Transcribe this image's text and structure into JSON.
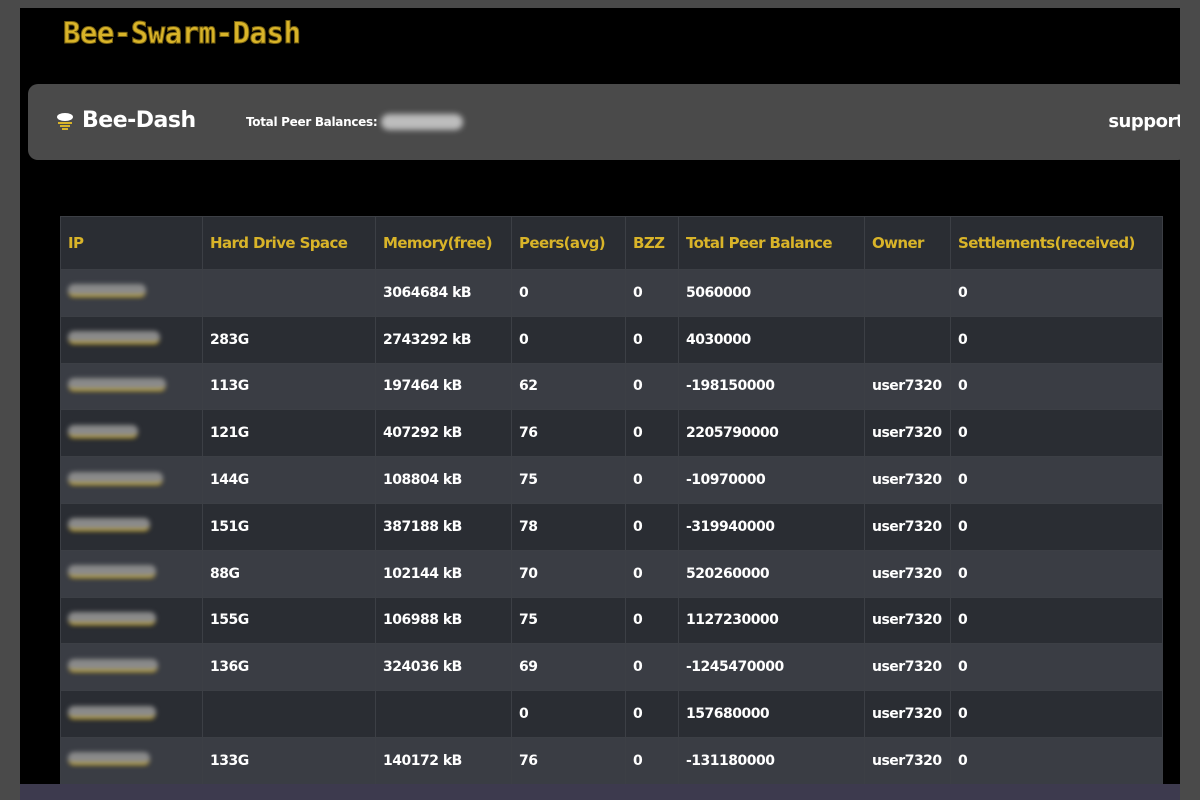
{
  "app_title": "Bee-Swarm-Dash",
  "navbar": {
    "brand": "Bee-Dash",
    "brand_icon": "bee-icon",
    "total_peer_balances_label": "Total Peer Balances:",
    "support_label": "support"
  },
  "colors": {
    "accent": "#d9b429",
    "background": "#000000",
    "navbar": "#4a4a4a",
    "row_dark": "#2a2d33",
    "row_light": "#3a3d44"
  },
  "table": {
    "headers": [
      "IP",
      "Hard Drive Space",
      "Memory(free)",
      "Peers(avg)",
      "BZZ",
      "Total Peer Balance",
      "Owner",
      "Settlements(received)"
    ],
    "rows": [
      {
        "hdd": "",
        "memory": "3064684 kB",
        "peers": "0",
        "bzz": "0",
        "balance": "5060000",
        "owner": "",
        "settlements": "0"
      },
      {
        "hdd": "283G",
        "memory": "2743292 kB",
        "peers": "0",
        "bzz": "0",
        "balance": "4030000",
        "owner": "",
        "settlements": "0"
      },
      {
        "hdd": "113G",
        "memory": "197464 kB",
        "peers": "62",
        "bzz": "0",
        "balance": "-198150000",
        "owner": "user7320",
        "settlements": "0"
      },
      {
        "hdd": "121G",
        "memory": "407292 kB",
        "peers": "76",
        "bzz": "0",
        "balance": "2205790000",
        "owner": "user7320",
        "settlements": "0"
      },
      {
        "hdd": "144G",
        "memory": "108804 kB",
        "peers": "75",
        "bzz": "0",
        "balance": "-10970000",
        "owner": "user7320",
        "settlements": "0"
      },
      {
        "hdd": "151G",
        "memory": "387188 kB",
        "peers": "78",
        "bzz": "0",
        "balance": "-319940000",
        "owner": "user7320",
        "settlements": "0"
      },
      {
        "hdd": "88G",
        "memory": "102144 kB",
        "peers": "70",
        "bzz": "0",
        "balance": "520260000",
        "owner": "user7320",
        "settlements": "0"
      },
      {
        "hdd": "155G",
        "memory": "106988 kB",
        "peers": "75",
        "bzz": "0",
        "balance": "1127230000",
        "owner": "user7320",
        "settlements": "0"
      },
      {
        "hdd": "136G",
        "memory": "324036 kB",
        "peers": "69",
        "bzz": "0",
        "balance": "-1245470000",
        "owner": "user7320",
        "settlements": "0"
      },
      {
        "hdd": "",
        "memory": "",
        "peers": "0",
        "bzz": "0",
        "balance": "157680000",
        "owner": "user7320",
        "settlements": "0"
      },
      {
        "hdd": "133G",
        "memory": "140172 kB",
        "peers": "76",
        "bzz": "0",
        "balance": "-131180000",
        "owner": "user7320",
        "settlements": "0"
      }
    ]
  }
}
